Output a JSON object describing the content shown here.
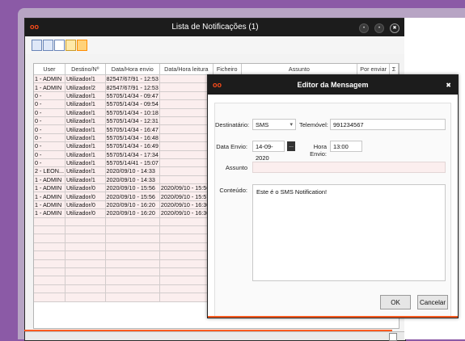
{
  "main_window": {
    "title": "Lista de Notificações (1)",
    "logo": "oo",
    "controls": [
      "•",
      "•",
      "✖"
    ]
  },
  "toolbar": {
    "icons": [
      "add-icon",
      "remove-icon",
      "document-icon",
      "export-icon",
      "edit-icon"
    ]
  },
  "table": {
    "columns": [
      "User",
      "Destino/Nº",
      "Data/Hora envio",
      "Data/Hora leitura",
      "Ficheiro",
      "Assunto",
      "Por enviar",
      "Σ"
    ],
    "rows": [
      [
        "1 - ADMIN",
        "Utilizador/1",
        "82547/67/91 - 12:53",
        "",
        "",
        "",
        "",
        ""
      ],
      [
        "1 - ADMIN",
        "Utilizador/2",
        "82547/67/91 - 12:53",
        "",
        "",
        "",
        "",
        ""
      ],
      [
        "0 -",
        "Utilizador/1",
        "55705/14/34 - 09:47",
        "",
        "",
        "",
        "",
        ""
      ],
      [
        "0 -",
        "Utilizador/1",
        "55705/14/34 - 09:54",
        "",
        "",
        "",
        "",
        ""
      ],
      [
        "0 -",
        "Utilizador/1",
        "55705/14/34 - 10:18",
        "",
        "",
        "",
        "",
        ""
      ],
      [
        "0 -",
        "Utilizador/1",
        "55705/14/34 - 12:31",
        "",
        "",
        "",
        "",
        ""
      ],
      [
        "0 -",
        "Utilizador/1",
        "55705/14/34 - 16:47",
        "",
        "",
        "",
        "",
        ""
      ],
      [
        "0 -",
        "Utilizador/1",
        "55705/14/34 - 16:48",
        "",
        "",
        "",
        "",
        ""
      ],
      [
        "0 -",
        "Utilizador/1",
        "55705/14/34 - 16:49",
        "",
        "",
        "",
        "",
        ""
      ],
      [
        "0 -",
        "Utilizador/1",
        "55705/14/34 - 17:34",
        "",
        "",
        "",
        "",
        ""
      ],
      [
        "0 -",
        "Utilizador/1",
        "55705/14/41 - 15:07",
        "",
        "",
        "",
        "",
        ""
      ],
      [
        "2 - LEON...",
        "Utilizador/1",
        "2020/09/10 - 14:33",
        "",
        "",
        "",
        "",
        ""
      ],
      [
        "1 - ADMIN",
        "Utilizador/1",
        "2020/09/10 - 14:33",
        "",
        "",
        "",
        "",
        ""
      ],
      [
        "1 - ADMIN",
        "Utilizador/0",
        "2020/09/10 - 15:56",
        "2020/09/10 - 15:56",
        "",
        "",
        "",
        ""
      ],
      [
        "1 - ADMIN",
        "Utilizador/0",
        "2020/09/10 - 15:56",
        "2020/09/10 - 15:57",
        "",
        "",
        "",
        ""
      ],
      [
        "1 - ADMIN",
        "Utilizador/0",
        "2020/09/10 - 16:20",
        "2020/09/10 - 16:30",
        "",
        "",
        "",
        ""
      ],
      [
        "1 - ADMIN",
        "Utilizador/0",
        "2020/09/10 - 16:20",
        "2020/09/10 - 16:30",
        "",
        "",
        "",
        ""
      ]
    ],
    "empty_rows": 10
  },
  "dialog": {
    "logo": "oo",
    "title": "Editor da Mensagem",
    "close": "✖",
    "destinatario_label": "Destinatário:",
    "destinatario_value": "SMS",
    "telemovel_label": "Telemóvel:",
    "telemovel_value": "991234567",
    "data_envio_label": "Data Envio:",
    "data_envio_value": "14-09-2020",
    "hora_envio_label": "Hora Envio:",
    "hora_envio_value": "13:00",
    "assunto_label": "Assunto",
    "assunto_value": "",
    "conteudo_label": "Conteúdo:",
    "conteudo_value": "Este é o SMS Notification!",
    "ok_label": "OK",
    "cancel_label": "Cancelar",
    "calendar_glyph": "...",
    "combo_arrow": "▾"
  },
  "footer": {
    "scroll_glyph": "▭"
  },
  "colors": {
    "background": "#8b5aa6",
    "titlebar": "#1c1c1c",
    "accent": "#ff5a1f",
    "row_fill": "#fbeeee"
  }
}
